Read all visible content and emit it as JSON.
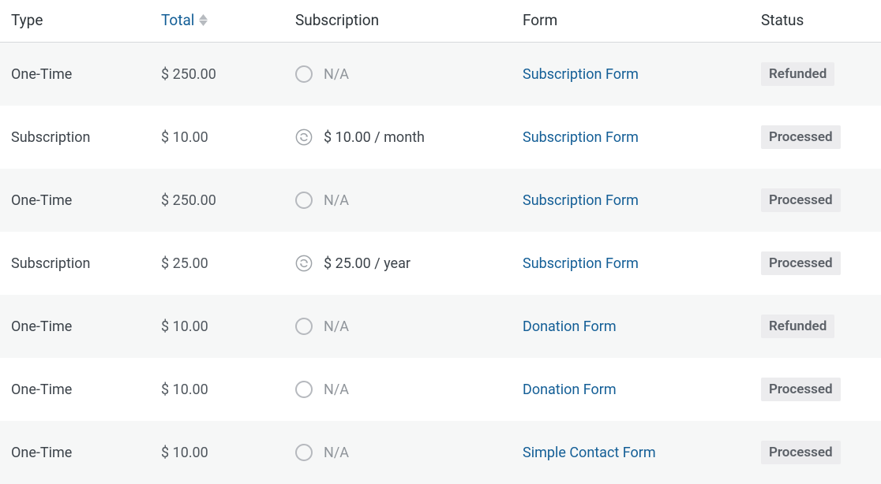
{
  "columns": {
    "type": "Type",
    "total": "Total",
    "subscription": "Subscription",
    "form": "Form",
    "status": "Status"
  },
  "rows": [
    {
      "type": "One-Time",
      "total": "$ 250.00",
      "sub_kind": "na",
      "sub_text": "N/A",
      "form": "Subscription Form",
      "status": "Refunded"
    },
    {
      "type": "Subscription",
      "total": "$ 10.00",
      "sub_kind": "renew",
      "sub_text": "$ 10.00 / month",
      "form": "Subscription Form",
      "status": "Processed"
    },
    {
      "type": "One-Time",
      "total": "$ 250.00",
      "sub_kind": "na",
      "sub_text": "N/A",
      "form": "Subscription Form",
      "status": "Processed"
    },
    {
      "type": "Subscription",
      "total": "$ 25.00",
      "sub_kind": "renew",
      "sub_text": "$ 25.00 / year",
      "form": "Subscription Form",
      "status": "Processed"
    },
    {
      "type": "One-Time",
      "total": "$ 10.00",
      "sub_kind": "na",
      "sub_text": "N/A",
      "form": "Donation Form",
      "status": "Refunded"
    },
    {
      "type": "One-Time",
      "total": "$ 10.00",
      "sub_kind": "na",
      "sub_text": "N/A",
      "form": "Donation Form",
      "status": "Processed"
    },
    {
      "type": "One-Time",
      "total": "$ 10.00",
      "sub_kind": "na",
      "sub_text": "N/A",
      "form": "Simple Contact Form",
      "status": "Processed"
    }
  ]
}
